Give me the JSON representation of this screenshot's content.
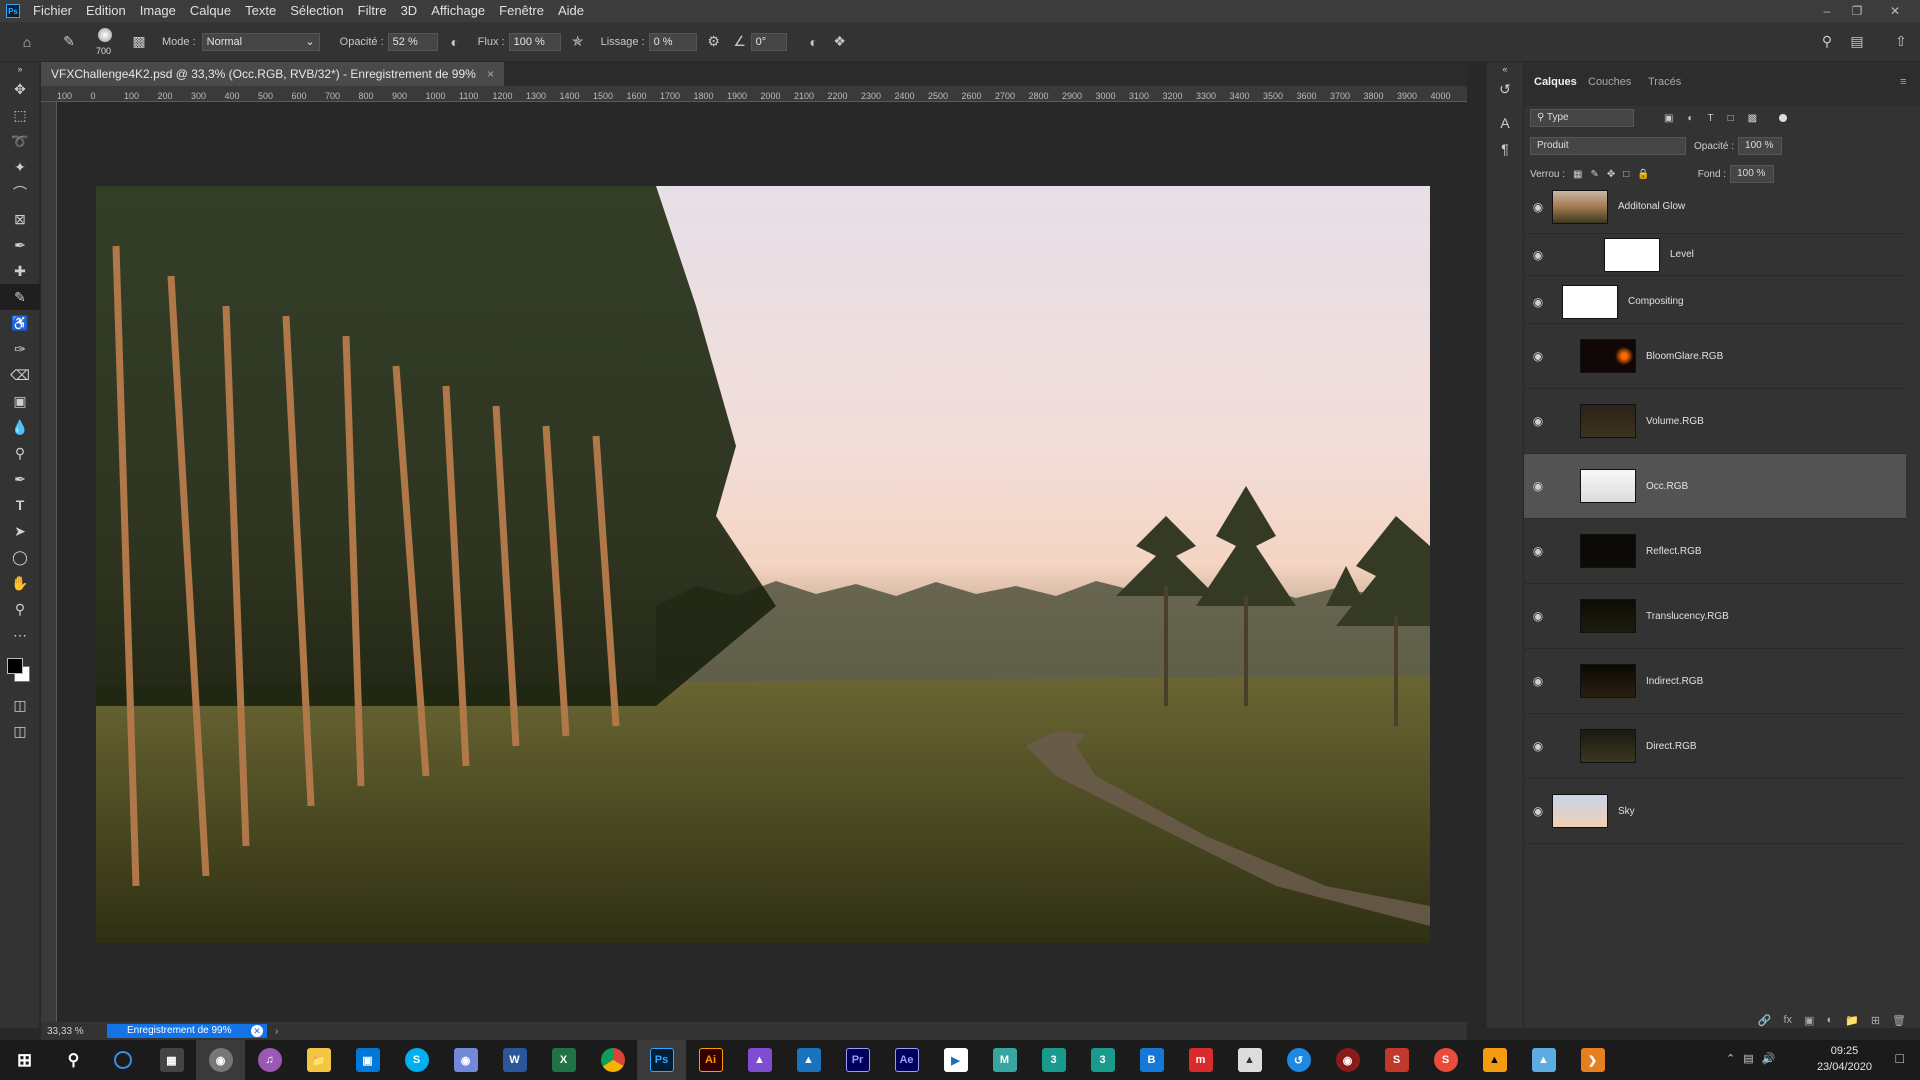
{
  "app": {
    "logo": "Ps",
    "menu": [
      "Fichier",
      "Edition",
      "Image",
      "Calque",
      "Texte",
      "Sélection",
      "Filtre",
      "3D",
      "Affichage",
      "Fenêtre",
      "Aide"
    ]
  },
  "options": {
    "brush_size": "700",
    "mode_label": "Mode :",
    "mode_value": "Normal",
    "opacity_label": "Opacité :",
    "opacity_value": "52 %",
    "flow_label": "Flux :",
    "flow_value": "100 %",
    "smoothing_label": "Lissage :",
    "smoothing_value": "0 %",
    "angle_value": "0°"
  },
  "document": {
    "tab_title": "VFXChallenge4K2.psd @ 33,3% (Occ.RGB, RVB/32*) - Enregistrement de 99%",
    "close": "×"
  },
  "ruler": {
    "ticks": [
      "100",
      "0",
      "100",
      "200",
      "300",
      "400",
      "500",
      "600",
      "700",
      "800",
      "900",
      "1000",
      "1100",
      "1200",
      "1300",
      "1400",
      "1500",
      "1600",
      "1700",
      "1800",
      "1900",
      "2000",
      "2100",
      "2200",
      "2300",
      "2400",
      "2500",
      "2600",
      "2700",
      "2800",
      "2900",
      "3000",
      "3100",
      "3200",
      "3300",
      "3400",
      "3500",
      "3600",
      "3700",
      "3800",
      "3900",
      "4000"
    ]
  },
  "status": {
    "zoom": "33,33 %",
    "saving": "Enregistrement de 99%",
    "progress": 0.99
  },
  "panel": {
    "tabs": [
      "Calques",
      "Couches",
      "Tracés"
    ],
    "filter_type": "Type",
    "blend_mode": "Produit",
    "opacity_label": "Opacité :",
    "opacity_value": "100 %",
    "lock_label": "Verrou :",
    "fill_label": "Fond :",
    "fill_value": "100 %",
    "layers": [
      {
        "name": "Additonal Glow",
        "selected": false
      },
      {
        "name": "Level",
        "selected": false
      },
      {
        "name": "Compositing",
        "selected": false
      },
      {
        "name": "BloomGlare.RGB",
        "selected": false
      },
      {
        "name": "Volume.RGB",
        "selected": false
      },
      {
        "name": "Occ.RGB",
        "selected": true
      },
      {
        "name": "Reflect.RGB",
        "selected": false
      },
      {
        "name": "Translucency.RGB",
        "selected": false
      },
      {
        "name": "Indirect.RGB",
        "selected": false
      },
      {
        "name": "Direct.RGB",
        "selected": false
      },
      {
        "name": "Sky",
        "selected": false
      }
    ]
  },
  "taskbar": {
    "time": "09:25",
    "date": "23/04/2020",
    "apps": [
      {
        "label": "P",
        "color": "#31a8ff",
        "bg": "#001e36",
        "name": "photoshop-taskbar-icon"
      },
      {
        "label": "Ai",
        "color": "#ff9a00",
        "bg": "#330000",
        "name": "illustrator-taskbar-icon"
      },
      {
        "label": "Pr",
        "color": "#9999ff",
        "bg": "#00005b",
        "name": "premiere-taskbar-icon"
      },
      {
        "label": "Ae",
        "color": "#9999ff",
        "bg": "#00005b",
        "name": "after-effects-taskbar-icon"
      }
    ]
  }
}
